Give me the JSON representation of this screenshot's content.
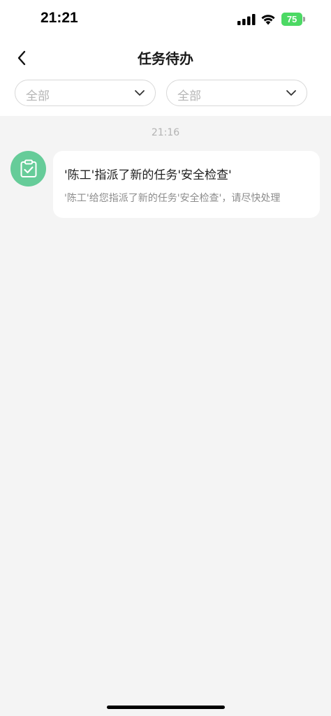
{
  "status_bar": {
    "time": "21:21",
    "battery_percent": "75",
    "battery_level": 0.75,
    "battery_color": "#4cd964",
    "icons": [
      "signal-icon",
      "wifi-icon",
      "battery-charging-icon"
    ]
  },
  "nav": {
    "title": "任务待办",
    "back_icon": "chevron-left-icon"
  },
  "filters": [
    {
      "label": "全部",
      "icon": "chevron-down-icon"
    },
    {
      "label": "全部",
      "icon": "chevron-down-icon"
    }
  ],
  "messages": [
    {
      "time": "21:16",
      "icon": "clipboard-check-icon",
      "avatar_color": "#66cc99",
      "title": "'陈工'指派了新的任务'安全检查'",
      "body": "'陈工'给您指派了新的任务'安全检查'，请尽快处理"
    }
  ],
  "colors": {
    "background": "#f4f4f4",
    "card": "#ffffff",
    "accent_green": "#66cc99"
  }
}
